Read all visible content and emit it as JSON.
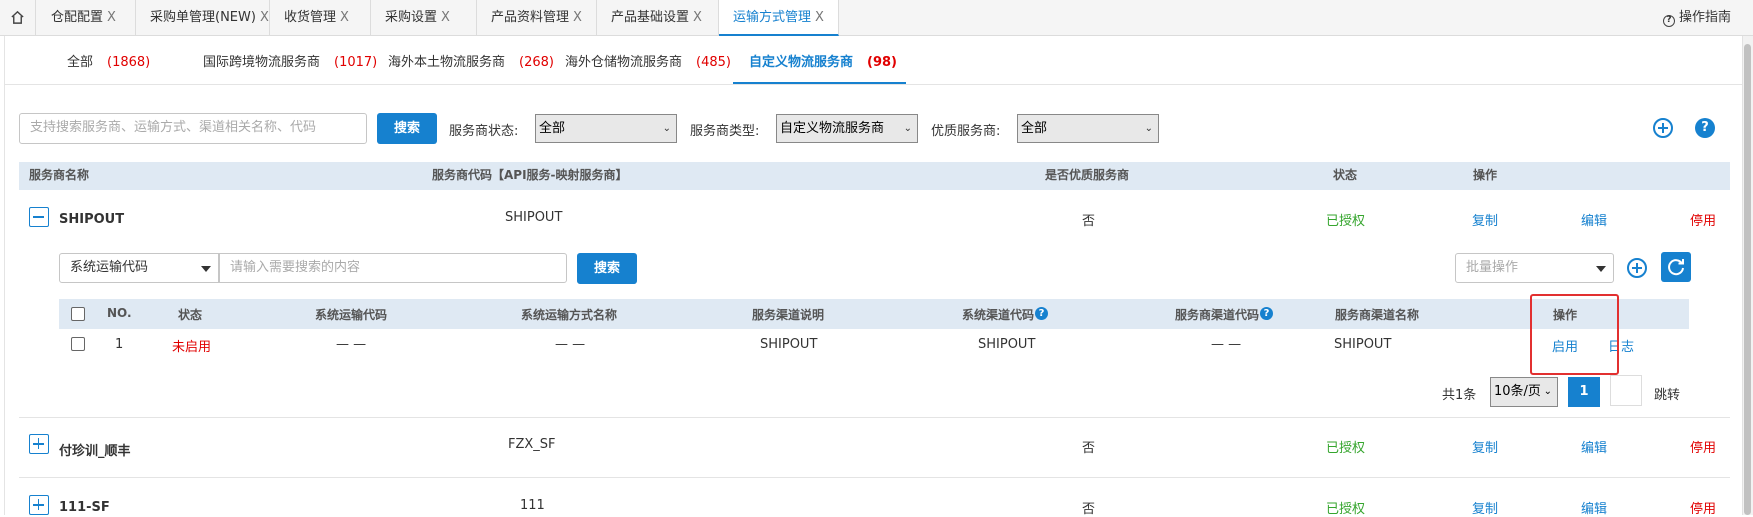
{
  "top_tabs": [
    {
      "label": "仓配配置"
    },
    {
      "label": "采购单管理(NEW)"
    },
    {
      "label": "收货管理"
    },
    {
      "label": "采购设置"
    },
    {
      "label": "产品资料管理"
    },
    {
      "label": "产品基础设置"
    },
    {
      "label": "运输方式管理"
    }
  ],
  "tab_close": "X",
  "guide_label": "操作指南",
  "guide_icon_glyph": "?",
  "category_tabs": [
    {
      "label": "全部",
      "count": "(1868)"
    },
    {
      "label": "国际跨境物流服务商",
      "count": "(1017)"
    },
    {
      "label": "海外本土物流服务商",
      "count": "(268)"
    },
    {
      "label": "海外仓储物流服务商",
      "count": "(485)"
    },
    {
      "label": "自定义物流服务商",
      "count": "(98)"
    }
  ],
  "filters": {
    "search_placeholder": "支持搜索服务商、运输方式、渠道相关名称、代码",
    "search_button": "搜索",
    "status_label": "服务商状态:",
    "status_value": "全部",
    "type_label": "服务商类型:",
    "type_value": "自定义物流服务商",
    "quality_label": "优质服务商:",
    "quality_value": "全部",
    "help_glyph": "?"
  },
  "table": {
    "headers": [
      "服务商名称",
      "服务商代码【API服务-映射服务商】",
      "是否优质服务商",
      "状态",
      "操作"
    ],
    "rows": [
      {
        "name": "SHIPOUT",
        "code": "SHIPOUT",
        "premium": "否",
        "status": "已授权",
        "copy": "复制",
        "edit": "编辑",
        "disable": "停用",
        "expanded": true
      },
      {
        "name": "付珍训_顺丰",
        "code": "FZX_SF",
        "premium": "否",
        "status": "已授权",
        "copy": "复制",
        "edit": "编辑",
        "disable": "停用",
        "expanded": false
      },
      {
        "name": "111-SF",
        "code": "111",
        "premium": "否",
        "status": "已授权",
        "copy": "复制",
        "edit": "编辑",
        "disable": "停用",
        "expanded": false
      }
    ]
  },
  "sub": {
    "field_select": "系统运输代码",
    "search_placeholder": "请输入需要搜索的内容",
    "search_button": "搜索",
    "batch_placeholder": "批量操作",
    "headers": [
      "NO.",
      "状态",
      "系统运输代码",
      "系统运输方式名称",
      "服务渠道说明",
      "系统渠道代码",
      "服务商渠道代码",
      "服务商渠道名称",
      "操作"
    ],
    "header_help_glyph": "?",
    "rows": [
      {
        "no": "1",
        "status": "未启用",
        "sys_code": "— —",
        "sys_name": "— —",
        "desc": "SHIPOUT",
        "channel_code": "SHIPOUT",
        "provider_channel_code": "— —",
        "provider_channel_name": "SHIPOUT",
        "enable": "启用",
        "log": "日志"
      }
    ],
    "pager": {
      "total": "共1条",
      "per_page": "10条/页",
      "current": "1",
      "jump": "跳转"
    }
  },
  "colors": {
    "accent": "#1681cf",
    "authorized": "#35a52d",
    "danger": "#e10000",
    "highlight": "#e23030"
  }
}
